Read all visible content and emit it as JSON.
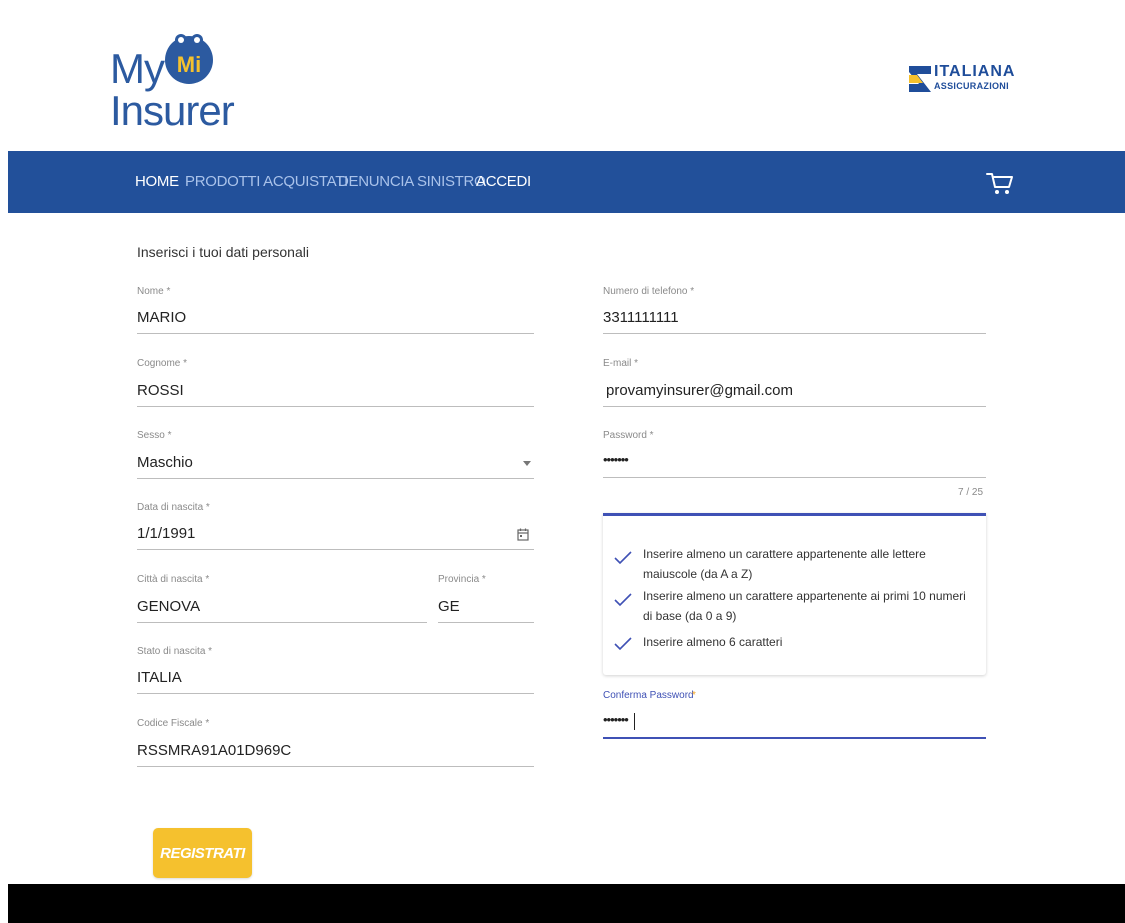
{
  "header": {
    "logo_line1": "My",
    "logo_badge": "Mi",
    "logo_line2": "Insurer",
    "brand_name": "ITALIANA",
    "brand_sub": "ASSICURAZIONI"
  },
  "nav": {
    "items": [
      {
        "label": "HOME",
        "active": true
      },
      {
        "label": "PRODOTTI ACQUISTATI",
        "active": false
      },
      {
        "label": "DENUNCIA SINISTRO",
        "active": false
      },
      {
        "label": "ACCEDI",
        "active": true
      }
    ],
    "cart_icon": "shopping-cart-icon"
  },
  "form": {
    "title": "Inserisci i tuoi dati personali",
    "nome": {
      "label": "Nome *",
      "value": "MARIO"
    },
    "cognome": {
      "label": "Cognome *",
      "value": "ROSSI"
    },
    "sesso": {
      "label": "Sesso *",
      "value": "Maschio"
    },
    "data_nascita": {
      "label": "Data di nascita *",
      "value": "1/1/1991"
    },
    "citta_nascita": {
      "label": "Città di nascita *",
      "value": "GENOVA"
    },
    "provincia": {
      "label": "Provincia *",
      "value": "GE"
    },
    "stato_nascita": {
      "label": "Stato di nascita *",
      "value": "ITALIA"
    },
    "codice_fiscale": {
      "label": "Codice Fiscale *",
      "value": "RSSMRA91A01D969C"
    },
    "telefono": {
      "label": "Numero di telefono *",
      "value": "3311111111"
    },
    "email": {
      "label": "E-mail *",
      "value": "provamyinsurer@gmail.com"
    },
    "password": {
      "label": "Password *",
      "value": "•••••••",
      "counter": "7 / 25"
    },
    "password_hints": [
      {
        "text": "Inserire almeno un carattere appartenente alle lettere maiuscole (da A a Z)"
      },
      {
        "text": "Inserire almeno un carattere appartenente ai primi 10 numeri di base (da 0 a 9)"
      },
      {
        "text": "Inserire almeno 6 caratteri"
      }
    ],
    "conferma_password": {
      "label": "Conferma Password",
      "required_mark": "*",
      "value": "•••••••"
    },
    "submit_label": "REGISTRATI"
  },
  "colors": {
    "nav_bg": "#22509a",
    "accent": "#3f51b5",
    "button": "#f5c12e",
    "check": "#3f51b5"
  }
}
